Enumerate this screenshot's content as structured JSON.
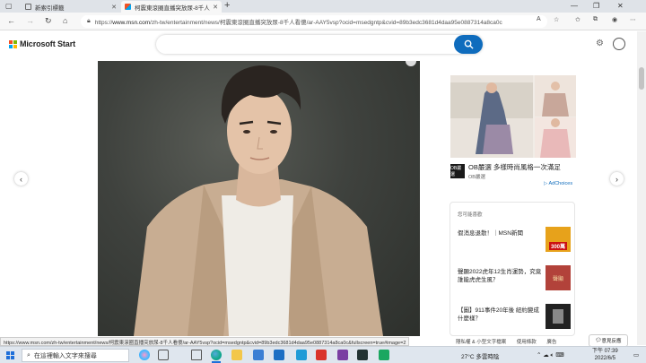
{
  "browser": {
    "tabs": [
      {
        "title": "新索引標籤",
        "active": false
      },
      {
        "title": "柯震東滾圈直播突放尿-8千人看傻",
        "active": true
      }
    ],
    "address": {
      "url_prefix": "https://",
      "url_host": "www.msn.com",
      "url_path": "/zh-tw/entertainment/news/柯震東滾圈直播突放尿-8千人看傻/ar-AAY5vsp?ocid=msedgntp&cvid=89b3edc3681d4daa95e0887314a8ca0c"
    }
  },
  "msn": {
    "brand": "Microsoft Start",
    "search_placeholder": ""
  },
  "ad": {
    "advertiser_logo": "OB嚴選",
    "headline": "OB嚴選 多樣時尚風格一次滿足",
    "source": "OB嚴選",
    "adchoices": "AdChoices"
  },
  "news_card": {
    "header": "您可能喜歡",
    "items": [
      {
        "title": "假消息退散！｜MSN新聞",
        "thumb_text": "300萬"
      },
      {
        "title": "聲顯2022虎年12生肖運勢，究竟誰能虎虎生風？",
        "thumb_text": "聲顯"
      },
      {
        "title": "【圖】911事件20年後 紐約變成什麼樣？",
        "thumb_text": ""
      }
    ]
  },
  "status_url": "https://www.msn.com/zh-tw/entertainment/news/柯震東滾圈直播突放尿-8千人看傻/ar-AAY5vsp?ocid=msedgntp&cvid=89b3edc3681d4daa95e0887314a8ca0c&fullscreen=true#image=2",
  "footer": {
    "links": [
      "隱私權 & 小型文字檔案",
      "使用條款",
      "廣告"
    ],
    "feedback": "意見反應"
  },
  "taskbar": {
    "search_placeholder": "在這裡輸入文字來搜尋",
    "weather": "27°C  多雲時陰",
    "time": "下午 07:39",
    "date": "2022/6/5"
  },
  "colors": {
    "accent": "#0f6cbd",
    "taskbar": "#dfe6ee"
  }
}
